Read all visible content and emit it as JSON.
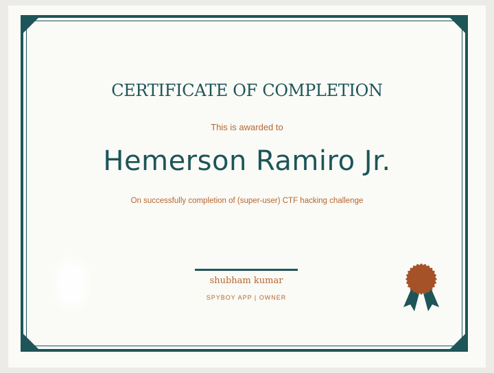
{
  "certificate": {
    "title": "CERTIFICATE OF COMPLETION",
    "awarded_text": "This is awarded to",
    "recipient_name": "Hemerson Ramiro Jr.",
    "reason": "On successfully completion of (super-user) CTF hacking challenge",
    "signer_name": "shubham kumar",
    "signer_role": "SPYBOY APP | OWNER"
  },
  "colors": {
    "accent": "#1d5558",
    "secondary": "#b5662f",
    "paper": "#fafaf6",
    "seal": "#a65228"
  },
  "icons": {
    "seal": "award-ribbon-icon"
  }
}
